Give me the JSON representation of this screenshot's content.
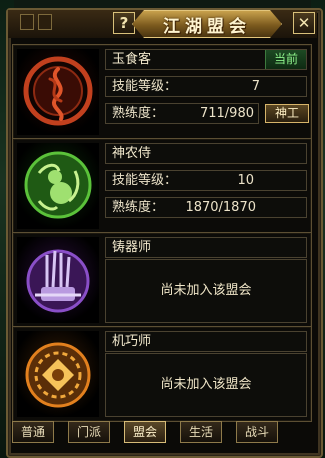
{
  "window": {
    "title": "江湖盟会",
    "help_label": "?",
    "close_label": "✕"
  },
  "jobs": [
    {
      "name": "玉食客",
      "status": "当前",
      "level_label": "技能等级：",
      "level_value": "7",
      "proficiency_label": "熟练度：",
      "proficiency_value": "711/980",
      "action_label": "神工",
      "emblem": "flame-coil-icon",
      "accent": "#c2401e"
    },
    {
      "name": "神农侍",
      "level_label": "技能等级：",
      "level_value": "10",
      "proficiency_label": "熟练度：",
      "proficiency_value": "1870/1870",
      "emblem": "gourd-vine-icon",
      "accent": "#5bc23a"
    },
    {
      "name": "铸器师",
      "empty_text": "尚未加入该盟会",
      "emblem": "weapon-rack-icon",
      "accent": "#8a4fc8"
    },
    {
      "name": "机巧师",
      "empty_text": "尚未加入该盟会",
      "emblem": "gear-flower-icon",
      "accent": "#e2801e"
    }
  ],
  "tabs": [
    {
      "label": "普通",
      "active": false
    },
    {
      "label": "门派",
      "active": false
    },
    {
      "label": "盟会",
      "active": true
    },
    {
      "label": "生活",
      "active": false
    },
    {
      "label": "战斗",
      "active": false
    }
  ]
}
